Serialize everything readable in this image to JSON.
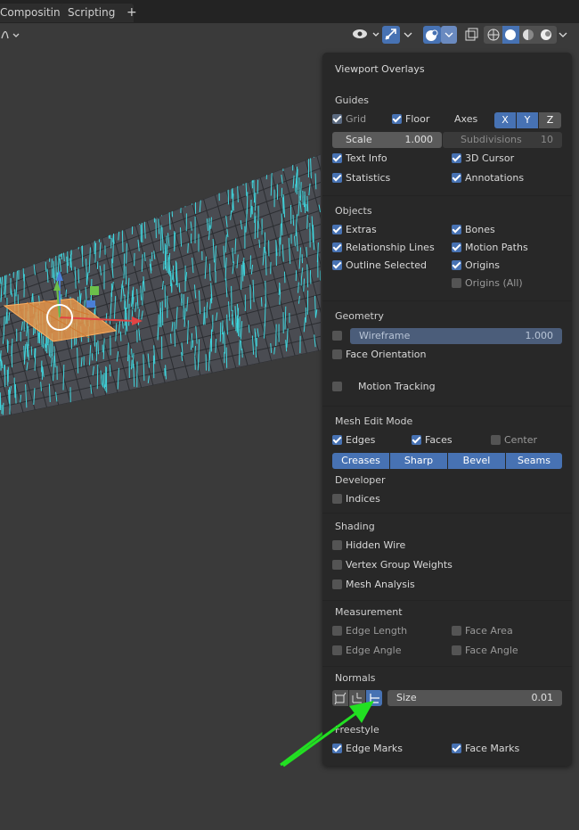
{
  "tabs": {
    "compositing": "Compositing",
    "scripting": "Scripting",
    "add": "+"
  },
  "overlays": {
    "title": "Viewport Overlays",
    "guides": {
      "label": "Guides",
      "grid": "Grid",
      "floor": "Floor",
      "axes": "Axes",
      "x": "X",
      "y": "Y",
      "z": "Z",
      "scale_label": "Scale",
      "scale_value": "1.000",
      "subdivisions_label": "Subdivisions",
      "subdivisions_value": "10",
      "text_info": "Text Info",
      "cursor": "3D Cursor",
      "statistics": "Statistics",
      "annotations": "Annotations"
    },
    "objects": {
      "label": "Objects",
      "extras": "Extras",
      "bones": "Bones",
      "relationship_lines": "Relationship Lines",
      "motion_paths": "Motion Paths",
      "outline_selected": "Outline Selected",
      "origins": "Origins",
      "origins_all": "Origins (All)"
    },
    "geometry": {
      "label": "Geometry",
      "wireframe": "Wireframe",
      "wireframe_value": "1.000",
      "face_orientation": "Face Orientation",
      "motion_tracking": "Motion Tracking"
    },
    "mesh_edit": {
      "label": "Mesh Edit Mode",
      "edges": "Edges",
      "faces": "Faces",
      "center": "Center",
      "creases": "Creases",
      "sharp": "Sharp",
      "bevel": "Bevel",
      "seams": "Seams"
    },
    "developer": {
      "label": "Developer",
      "indices": "Indices"
    },
    "shading": {
      "label": "Shading",
      "hidden_wire": "Hidden Wire",
      "vertex_group_weights": "Vertex Group Weights",
      "mesh_analysis": "Mesh Analysis"
    },
    "measurement": {
      "label": "Measurement",
      "edge_length": "Edge Length",
      "face_area": "Face Area",
      "edge_angle": "Edge Angle",
      "face_angle": "Face Angle"
    },
    "normals": {
      "label": "Normals",
      "size_label": "Size",
      "size_value": "0.01"
    },
    "freestyle": {
      "label": "Freestyle",
      "edge_marks": "Edge Marks",
      "face_marks": "Face Marks"
    }
  },
  "colors": {
    "accent": "#4772b3",
    "panel": "#282828",
    "wire": "#3fd8e0",
    "arrow": "#22e022",
    "selected_face": "#e8964a"
  }
}
